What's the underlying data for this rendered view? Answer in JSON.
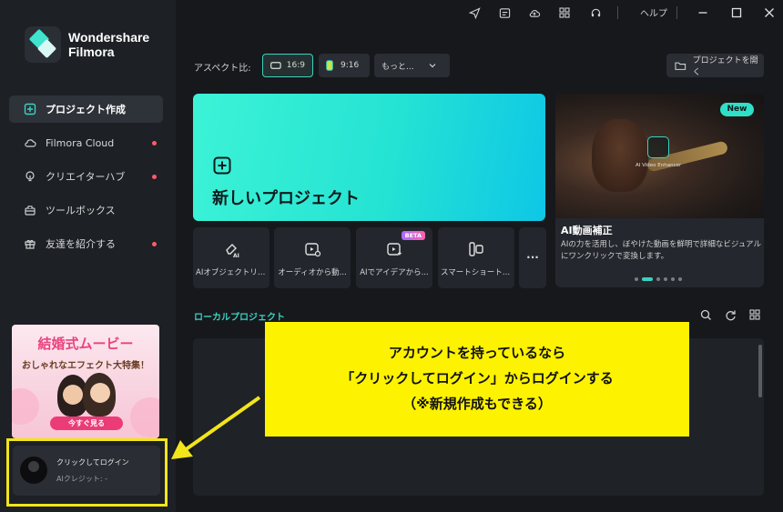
{
  "app": {
    "brand_line1": "Wondershare",
    "brand_line2": "Filmora"
  },
  "sidebar": {
    "items": [
      {
        "label": "プロジェクト作成",
        "icon": "plus-square-icon",
        "active": true,
        "dot": false
      },
      {
        "label": "Filmora Cloud",
        "icon": "cloud-icon",
        "active": false,
        "dot": true
      },
      {
        "label": "クリエイターハブ",
        "icon": "lightbulb-icon",
        "active": false,
        "dot": true
      },
      {
        "label": "ツールボックス",
        "icon": "toolbox-icon",
        "active": false,
        "dot": false
      },
      {
        "label": "友達を紹介する",
        "icon": "gift-icon",
        "active": false,
        "dot": true
      }
    ],
    "promo": {
      "title": "結婚式ムービー",
      "subtitle": "おしゃれなエフェクト大特集！",
      "cta": "今すぐ見る"
    },
    "login": {
      "name": "クリックしてログイン",
      "credit": "AIクレジット: -"
    }
  },
  "titlebar": {
    "help": "ヘルプ"
  },
  "toolbar": {
    "aspect_label": "アスペクト比:",
    "ratios": [
      {
        "label": "16:9",
        "active": true
      },
      {
        "label": "9:16",
        "active": false
      }
    ],
    "more": "もっと...",
    "open_project": "プロジェクトを開く"
  },
  "new_project": {
    "label": "新しいプロジェクト"
  },
  "tools": [
    {
      "label": "AIオブジェクトリム...",
      "icon": "ai-eraser-icon",
      "beta": ""
    },
    {
      "label": "オーディオから動...",
      "icon": "audio-to-video-icon",
      "beta": ""
    },
    {
      "label": "AIでアイデアから...",
      "icon": "ai-idea-video-icon",
      "beta": "BETA"
    },
    {
      "label": "スマートショートク...",
      "icon": "smart-short-clip-icon",
      "beta": ""
    }
  ],
  "feature": {
    "badge": "New",
    "image_label": "AI Video Enhancer",
    "title": "AI動画補正",
    "description": "AIの力を活用し、ぼやけた動画を鮮明で詳細なビジュアルにワンクリックで変換します。"
  },
  "local": {
    "label": "ローカルプロジェクト"
  },
  "annotation": {
    "line1": "アカウントを持っているなら",
    "line2": "「クリックしてログイン」からログインする",
    "line3": "（※新規作成もできる）",
    "color": "#fdf200"
  },
  "colors": {
    "accent": "#3bd1c0",
    "notify": "#ff5a6a",
    "highlight": "#f2e51a"
  }
}
